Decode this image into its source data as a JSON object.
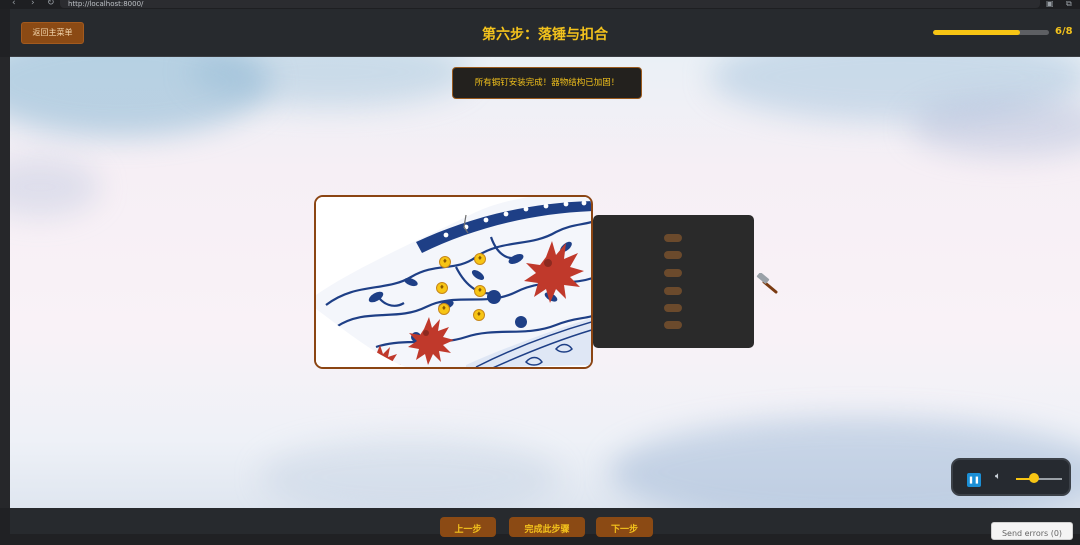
{
  "browser": {
    "url": "http://localhost:8000/"
  },
  "header": {
    "back_label": "返回主菜单",
    "title": "第六步：落锤与扣合",
    "progress_text": "6/8",
    "progress_fraction": 0.75,
    "accent_color": "#f3c21c"
  },
  "toast": {
    "message": "所有锔钉安装完成！器物结构已加固！"
  },
  "nails": {
    "count": 6,
    "color": "#6b4a2c"
  },
  "rivets": {
    "count": 6,
    "color": "#f7c514"
  },
  "audio": {
    "state": "playing",
    "volume": 0.4,
    "pause_icon": "pause-icon",
    "volume_icon": "speaker-icon"
  },
  "footer": {
    "prev_label": "上一步",
    "complete_label": "完成此步骤",
    "next_label": "下一步",
    "send_errors_label": "Send errors (0)"
  },
  "colors": {
    "brand_button": "#8b4a14",
    "panel": "#2a2a2a"
  }
}
